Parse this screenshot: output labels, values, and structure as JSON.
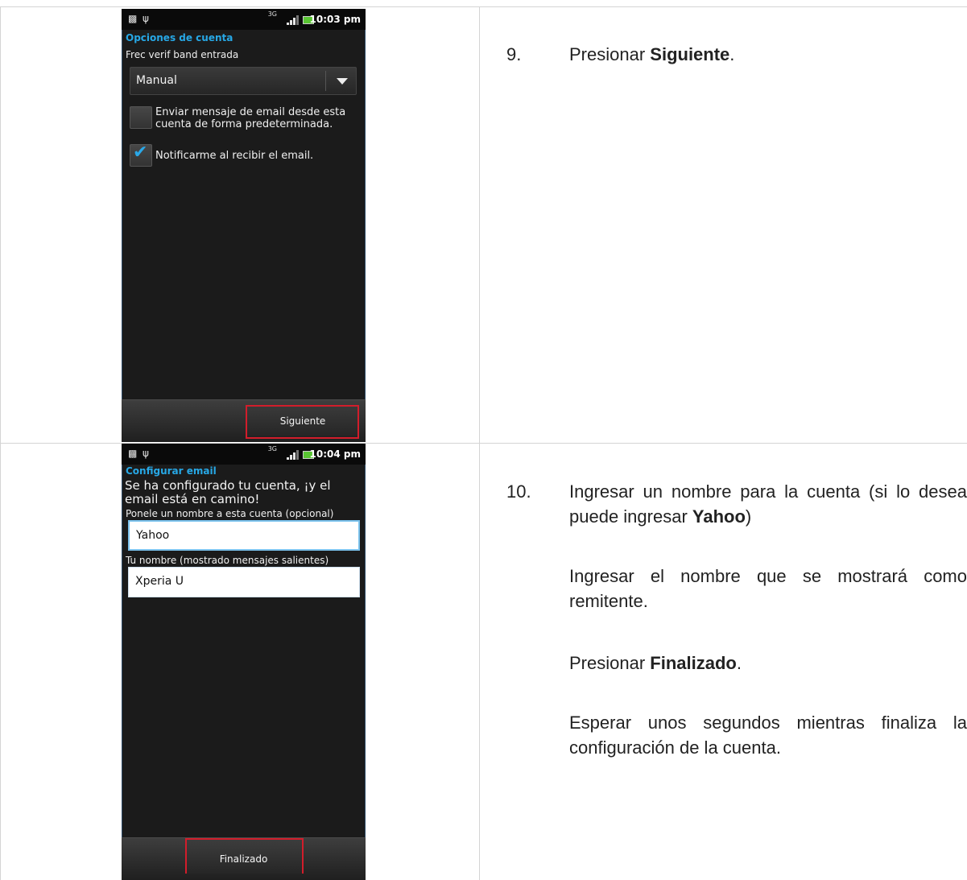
{
  "screen1": {
    "status_time": "10:03 pm",
    "network": "3G",
    "title": "Opciones de cuenta",
    "freq_label": "Frec verif band entrada",
    "dropdown_value": "Manual",
    "checkbox1_label": "Enviar mensaje de email desde esta cuenta de forma predeterminada.",
    "checkbox1_checked": false,
    "checkbox2_label": "Notificarme al recibir el email.",
    "checkbox2_checked": true,
    "next_button": "Siguiente"
  },
  "screen2": {
    "status_time": "10:04 pm",
    "network": "3G",
    "title": "Configurar email",
    "message": "Se ha configurado tu cuenta, ¡y el email está en camino!",
    "account_name_label": "Ponele un nombre a esta cuenta (opcional)",
    "account_name_value": "Yahoo",
    "your_name_label": "Tu nombre (mostrado mensajes salientes)",
    "your_name_value": "Xperia U",
    "done_button": "Finalizado"
  },
  "step9": {
    "number": "9.",
    "text_prefix": "Presionar ",
    "text_bold": "Siguiente",
    "text_suffix": "."
  },
  "step10": {
    "number": "10.",
    "line1_prefix": "Ingresar un nombre para la cuenta (si lo desea puede ingresar ",
    "line1_bold": "Yahoo",
    "line1_suffix": ")",
    "para2": "Ingresar el nombre que se mostrará como remitente.",
    "para3_prefix": "Presionar ",
    "para3_bold": "Finalizado",
    "para3_suffix": ".",
    "para4": "Esperar unos segundos mientras finaliza la configuración de la cuenta."
  },
  "colors": {
    "accent_blue": "#27a8e6",
    "highlight_red": "#d21d2b",
    "table_border": "#d4d4d4"
  }
}
